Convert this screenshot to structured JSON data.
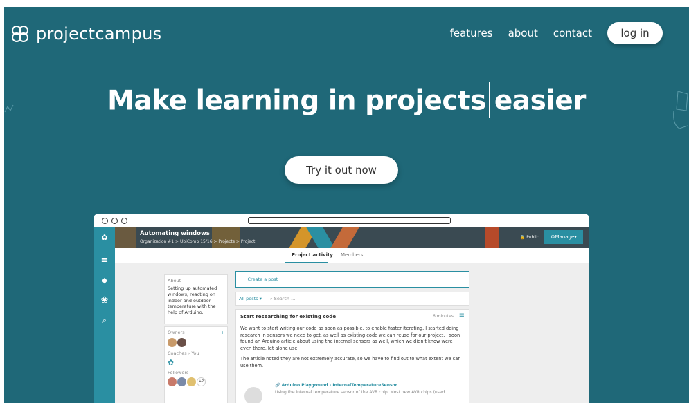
{
  "brand": {
    "name": "projectcampus"
  },
  "nav": {
    "features": "features",
    "about": "about",
    "contact": "contact",
    "login": "log in"
  },
  "hero": {
    "headline_a": "Make learning in projects",
    "headline_b": "easier",
    "cta": "Try it out now"
  },
  "app": {
    "project_title": "Automating windows",
    "breadcrumb": "Organization #1  >  UbiComp 15/16  >  Projects  >  Project",
    "visibility": "Public",
    "manage": "Manage",
    "tabs": [
      "Project activity",
      "Members"
    ],
    "about": {
      "label": "About",
      "text": "Setting up automated windows, reacting on indoor and outdoor temperature with the help of Arduino."
    },
    "people": {
      "owners": "Owners",
      "coaches": "Coaches",
      "you": "You",
      "followers": "Followers",
      "more_count": "+2",
      "add": "+"
    },
    "create_post": "Create a post",
    "filter": "All posts",
    "search_placeholder": "Search ...",
    "post": {
      "title": "Start researching for existing code",
      "time": "6 minutes",
      "para1": "We want to start writing our code as soon as possible, to enable faster iterating. I started doing research in sensors we need to get, as well as existing code we can reuse for our project. I soon found an Arduino article about using the internal sensors as well, which we didn't know were even there, let alone use.",
      "para2": "The article noted they are not extremely accurate, so we have to find out to what extent we can use them.",
      "link_title": "Arduino Playground - InternalTemperatureSensor",
      "link_desc": "Using the internal temperature sensor of the AVR chip. Most new AVR chips (used..."
    }
  },
  "colors": {
    "hero_bg": "#1f6878",
    "accent": "#2a8fa2"
  }
}
